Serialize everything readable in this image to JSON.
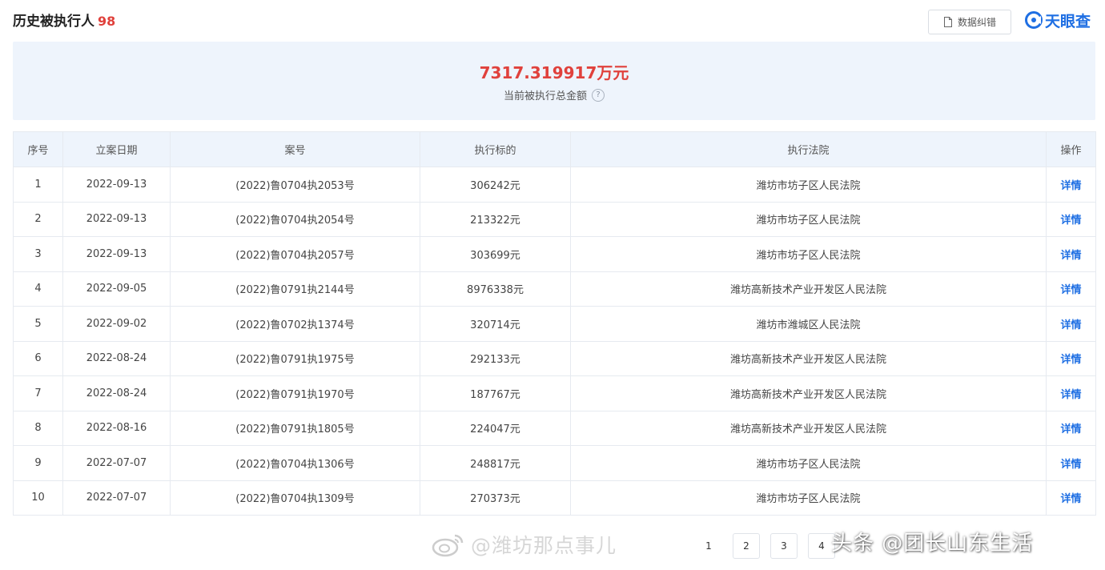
{
  "header": {
    "title": "历史被执行人",
    "count": "98",
    "export_label": "数据纠错",
    "logo_text": "天眼查",
    "export_icon": "document-icon",
    "logo_icon": "tianyancha-logo-icon"
  },
  "summary": {
    "amount": "7317.319917万元",
    "label": "当前被执行总金额",
    "help_icon": "?"
  },
  "table": {
    "columns": [
      "序号",
      "立案日期",
      "案号",
      "执行标的",
      "执行法院",
      "操作"
    ],
    "rows": [
      {
        "no": "1",
        "date": "2022-09-13",
        "case": "(2022)鲁0704执2053号",
        "amount": "306242元",
        "court": "潍坊市坊子区人民法院",
        "action": "详情"
      },
      {
        "no": "2",
        "date": "2022-09-13",
        "case": "(2022)鲁0704执2054号",
        "amount": "213322元",
        "court": "潍坊市坊子区人民法院",
        "action": "详情"
      },
      {
        "no": "3",
        "date": "2022-09-13",
        "case": "(2022)鲁0704执2057号",
        "amount": "303699元",
        "court": "潍坊市坊子区人民法院",
        "action": "详情"
      },
      {
        "no": "4",
        "date": "2022-09-05",
        "case": "(2022)鲁0791执2144号",
        "amount": "8976338元",
        "court": "潍坊高新技术产业开发区人民法院",
        "action": "详情"
      },
      {
        "no": "5",
        "date": "2022-09-02",
        "case": "(2022)鲁0702执1374号",
        "amount": "320714元",
        "court": "潍坊市潍城区人民法院",
        "action": "详情"
      },
      {
        "no": "6",
        "date": "2022-08-24",
        "case": "(2022)鲁0791执1975号",
        "amount": "292133元",
        "court": "潍坊高新技术产业开发区人民法院",
        "action": "详情"
      },
      {
        "no": "7",
        "date": "2022-08-24",
        "case": "(2022)鲁0791执1970号",
        "amount": "187767元",
        "court": "潍坊高新技术产业开发区人民法院",
        "action": "详情"
      },
      {
        "no": "8",
        "date": "2022-08-16",
        "case": "(2022)鲁0791执1805号",
        "amount": "224047元",
        "court": "潍坊高新技术产业开发区人民法院",
        "action": "详情"
      },
      {
        "no": "9",
        "date": "2022-07-07",
        "case": "(2022)鲁0704执1306号",
        "amount": "248817元",
        "court": "潍坊市坊子区人民法院",
        "action": "详情"
      },
      {
        "no": "10",
        "date": "2022-07-07",
        "case": "(2022)鲁0704执1309号",
        "amount": "270373元",
        "court": "潍坊市坊子区人民法院",
        "action": "详情"
      }
    ]
  },
  "pagination": {
    "pages": [
      "1",
      "2",
      "3",
      "4"
    ],
    "current": "1"
  },
  "watermarks": {
    "weibo": "@潍坊那点事儿",
    "toutiao": "头条 @团长山东生活"
  },
  "colors": {
    "accent_red": "#e0413c",
    "link_blue": "#1f6fe3",
    "header_bg": "#eef4fc"
  }
}
